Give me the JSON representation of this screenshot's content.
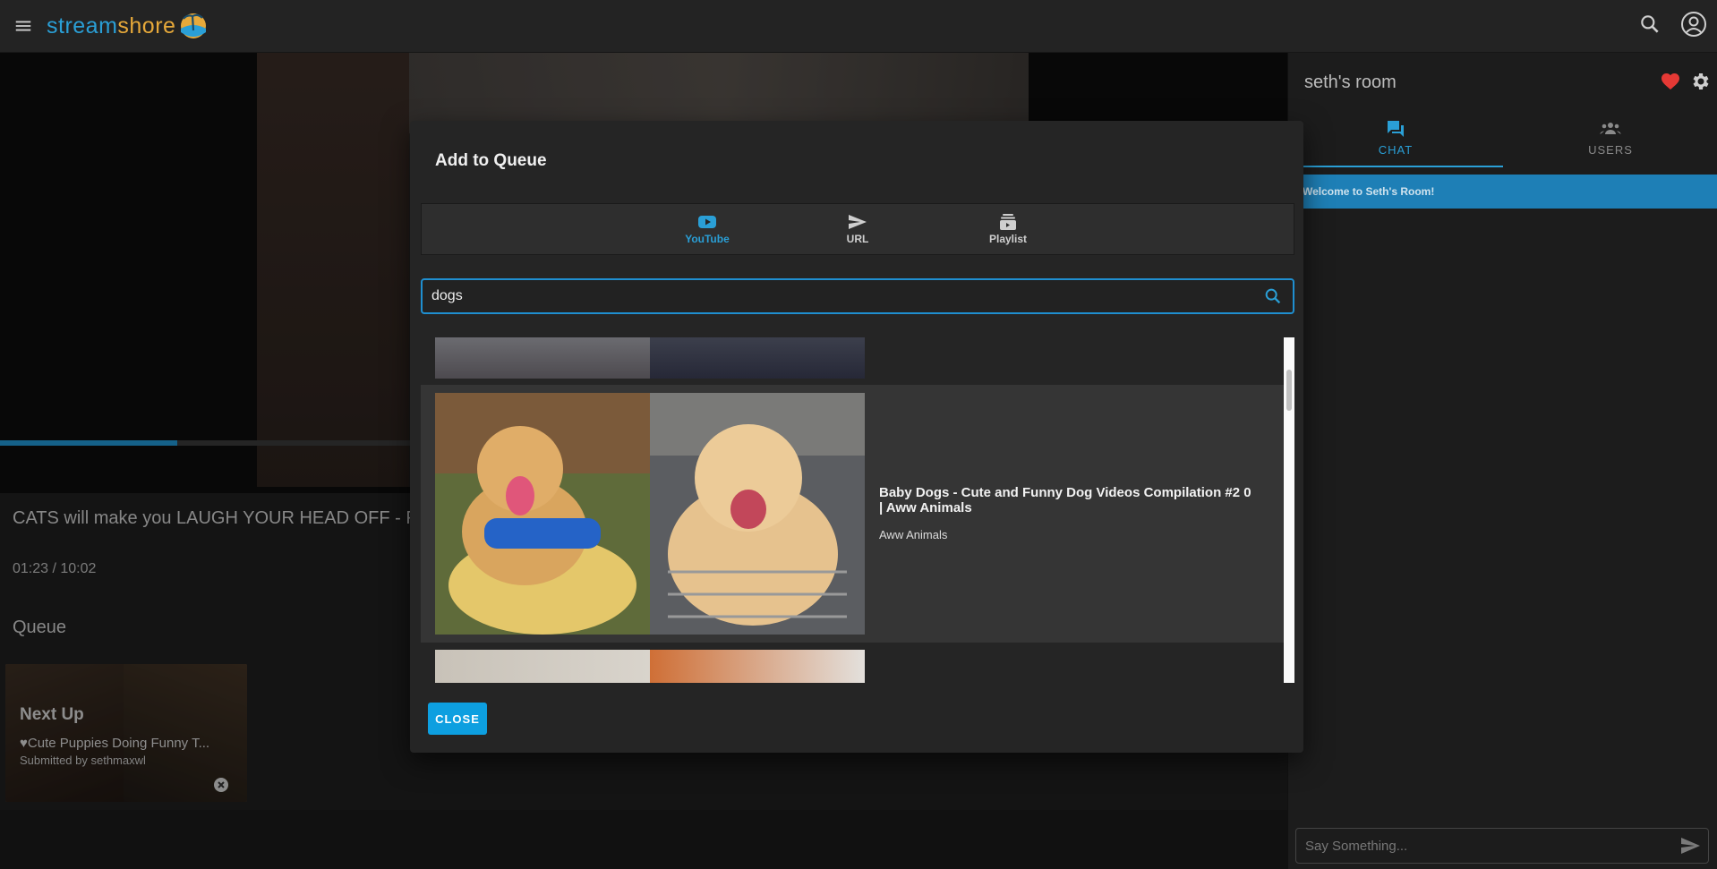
{
  "app": {
    "logo_part1": "stream",
    "logo_part2": "shore"
  },
  "player": {
    "now_playing_title": "CATS will make you LAUGH YOUR HEAD OFF - Fun",
    "time": "01:23 / 10:02",
    "progress": 0.138
  },
  "queue": {
    "heading": "Queue",
    "next_label": "Next Up",
    "next_title": "♥Cute Puppies Doing Funny T...",
    "submitted_by": "Submitted by sethmaxwl"
  },
  "sidebar": {
    "room_title": "seth's room",
    "tabs": [
      {
        "label": "CHAT",
        "icon": "chat-icon",
        "active": true
      },
      {
        "label": "USERS",
        "icon": "users-icon",
        "active": false
      }
    ],
    "welcome": "Welcome to Seth's Room!",
    "chat_placeholder": "Say Something..."
  },
  "dialog": {
    "title": "Add to Queue",
    "tabs": [
      {
        "label": "YouTube",
        "icon": "youtube-icon",
        "active": true
      },
      {
        "label": "URL",
        "icon": "send-icon",
        "active": false
      },
      {
        "label": "Playlist",
        "icon": "playlist-icon",
        "active": false
      }
    ],
    "search_value": "dogs",
    "results": [
      {
        "title": "Baby Dogs - Cute and Funny Dog Videos Compilation #2 0 | Aww Animals",
        "channel": "Aww Animals"
      }
    ],
    "close_label": "CLOSE"
  },
  "colors": {
    "accent": "#2a9fd6",
    "close_button": "#0d9fe0",
    "heart": "#e53935"
  }
}
